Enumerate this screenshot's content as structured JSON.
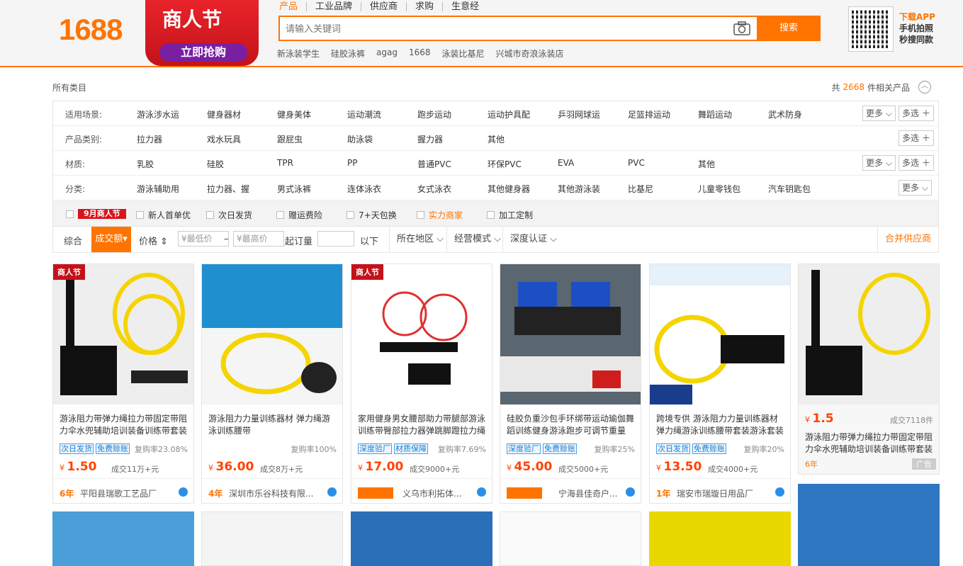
{
  "header": {
    "logo": "1688",
    "promo_title": "商人节",
    "promo_button": "立即抢购",
    "search_tabs": [
      "产品",
      "工业品牌",
      "供应商",
      "求购",
      "生意经"
    ],
    "search_placeholder": "请输入关键词",
    "search_button": "搜索",
    "hot_words": [
      "新泳装学生",
      "硅胶泳裤",
      "agag",
      "1668",
      "泳装比基尼",
      "兴城市奇浪泳装店"
    ],
    "app_lines": [
      "下载APP",
      "手机拍照",
      "秒搜同款"
    ]
  },
  "breadcrumb": "所有类目",
  "total": {
    "prefix": "共",
    "count": "2668",
    "suffix": "件相关产品"
  },
  "filters": [
    {
      "label": "适用场景:",
      "options": [
        "游泳涉水运",
        "健身器材",
        "健身美体",
        "运动潮流",
        "跑步运动",
        "运动护具配",
        "乒羽网球运",
        "足篮排运动",
        "舞蹈运动",
        "武术防身"
      ],
      "more": "更多",
      "multi": "多选"
    },
    {
      "label": "产品类别:",
      "options": [
        "拉力器",
        "戏水玩具",
        "跟屁虫",
        "助泳袋",
        "握力器",
        "其他"
      ],
      "multi": "多选"
    },
    {
      "label": "材质:",
      "options": [
        "乳胶",
        "硅胶",
        "TPR",
        "PP",
        "普通PVC",
        "环保PVC",
        "EVA",
        "PVC",
        "其他"
      ],
      "more": "更多",
      "multi": "多选"
    },
    {
      "label": "分类:",
      "options": [
        "游泳辅助用",
        "拉力器、握",
        "男式泳裤",
        "连体泳衣",
        "女式泳衣",
        "其他健身器",
        "其他游泳装",
        "比基尼",
        "儿童零钱包",
        "汽车钥匙包"
      ],
      "more": "更多"
    }
  ],
  "checks": [
    "9月商人节",
    "新人首单优",
    "次日发货",
    "赠运费险",
    "7+天包换",
    "实力商家",
    "加工定制"
  ],
  "sort": {
    "items": [
      "综合",
      "成交额",
      "价格"
    ],
    "min_price": "¥最低价",
    "max_price": "¥最高价",
    "moq_label": "起订量",
    "moq_suffix": "以下",
    "selects": [
      "所在地区",
      "经营模式",
      "深度认证"
    ],
    "merge": "合并供应商"
  },
  "products": [
    {
      "title": "游泳阻力带弹力绳拉力带固定带阻力伞水兜辅助培训装备训练带套装",
      "tags": [
        "次日发货",
        "免费赊账"
      ],
      "rate": "复购率23.08%",
      "price": "1.50",
      "sold": "成交11万+元",
      "years": "6年",
      "shop": "平阳县瑞歌工艺品厂"
    },
    {
      "title": "游泳阻力力量训练器材 弹力绳游泳训练腰带",
      "tags": [],
      "rate": "复购率100%",
      "price": "36.00",
      "sold": "成交8万+元",
      "years": "4年",
      "shop": "深圳市乐谷科技有限..."
    },
    {
      "title": "家用健身男女腰部助力带腿部游泳训练带臀部拉力器弹跳脚蹬拉力绳",
      "tags": [
        "深度验厂",
        "材质保障"
      ],
      "rate": "复购率7.69%",
      "price": "17.00",
      "sold": "成交9000+元",
      "years": "实力工厂",
      "shop": "义乌市利拓体..."
    },
    {
      "title": "硅胶负重沙包手环绑带运动瑜伽舞蹈训练健身游泳跑步可调节重量",
      "tags": [
        "深度验厂",
        "免费赊账"
      ],
      "rate": "复购率25%",
      "price": "45.00",
      "sold": "成交5000+元",
      "years": "实力工厂",
      "shop": "宁海县佳奇户..."
    },
    {
      "title": "跨境专供 游泳阻力力量训练器材弹力绳游泳训练腰带套装游泳套装",
      "tags": [
        "次日发货",
        "免费赊账"
      ],
      "rate": "复购率20%",
      "price": "13.50",
      "sold": "成交4000+元",
      "years": "1年",
      "shop": "瑞安市瑞璇日用品厂"
    },
    {
      "title": "游泳阻力带弹力绳拉力带固定带阻力伞水兜辅助培训装备训练带套装",
      "tags": [],
      "rate": "",
      "price": "1.5",
      "sold": "成交7118件",
      "years": "6年",
      "shop": "广告"
    }
  ]
}
